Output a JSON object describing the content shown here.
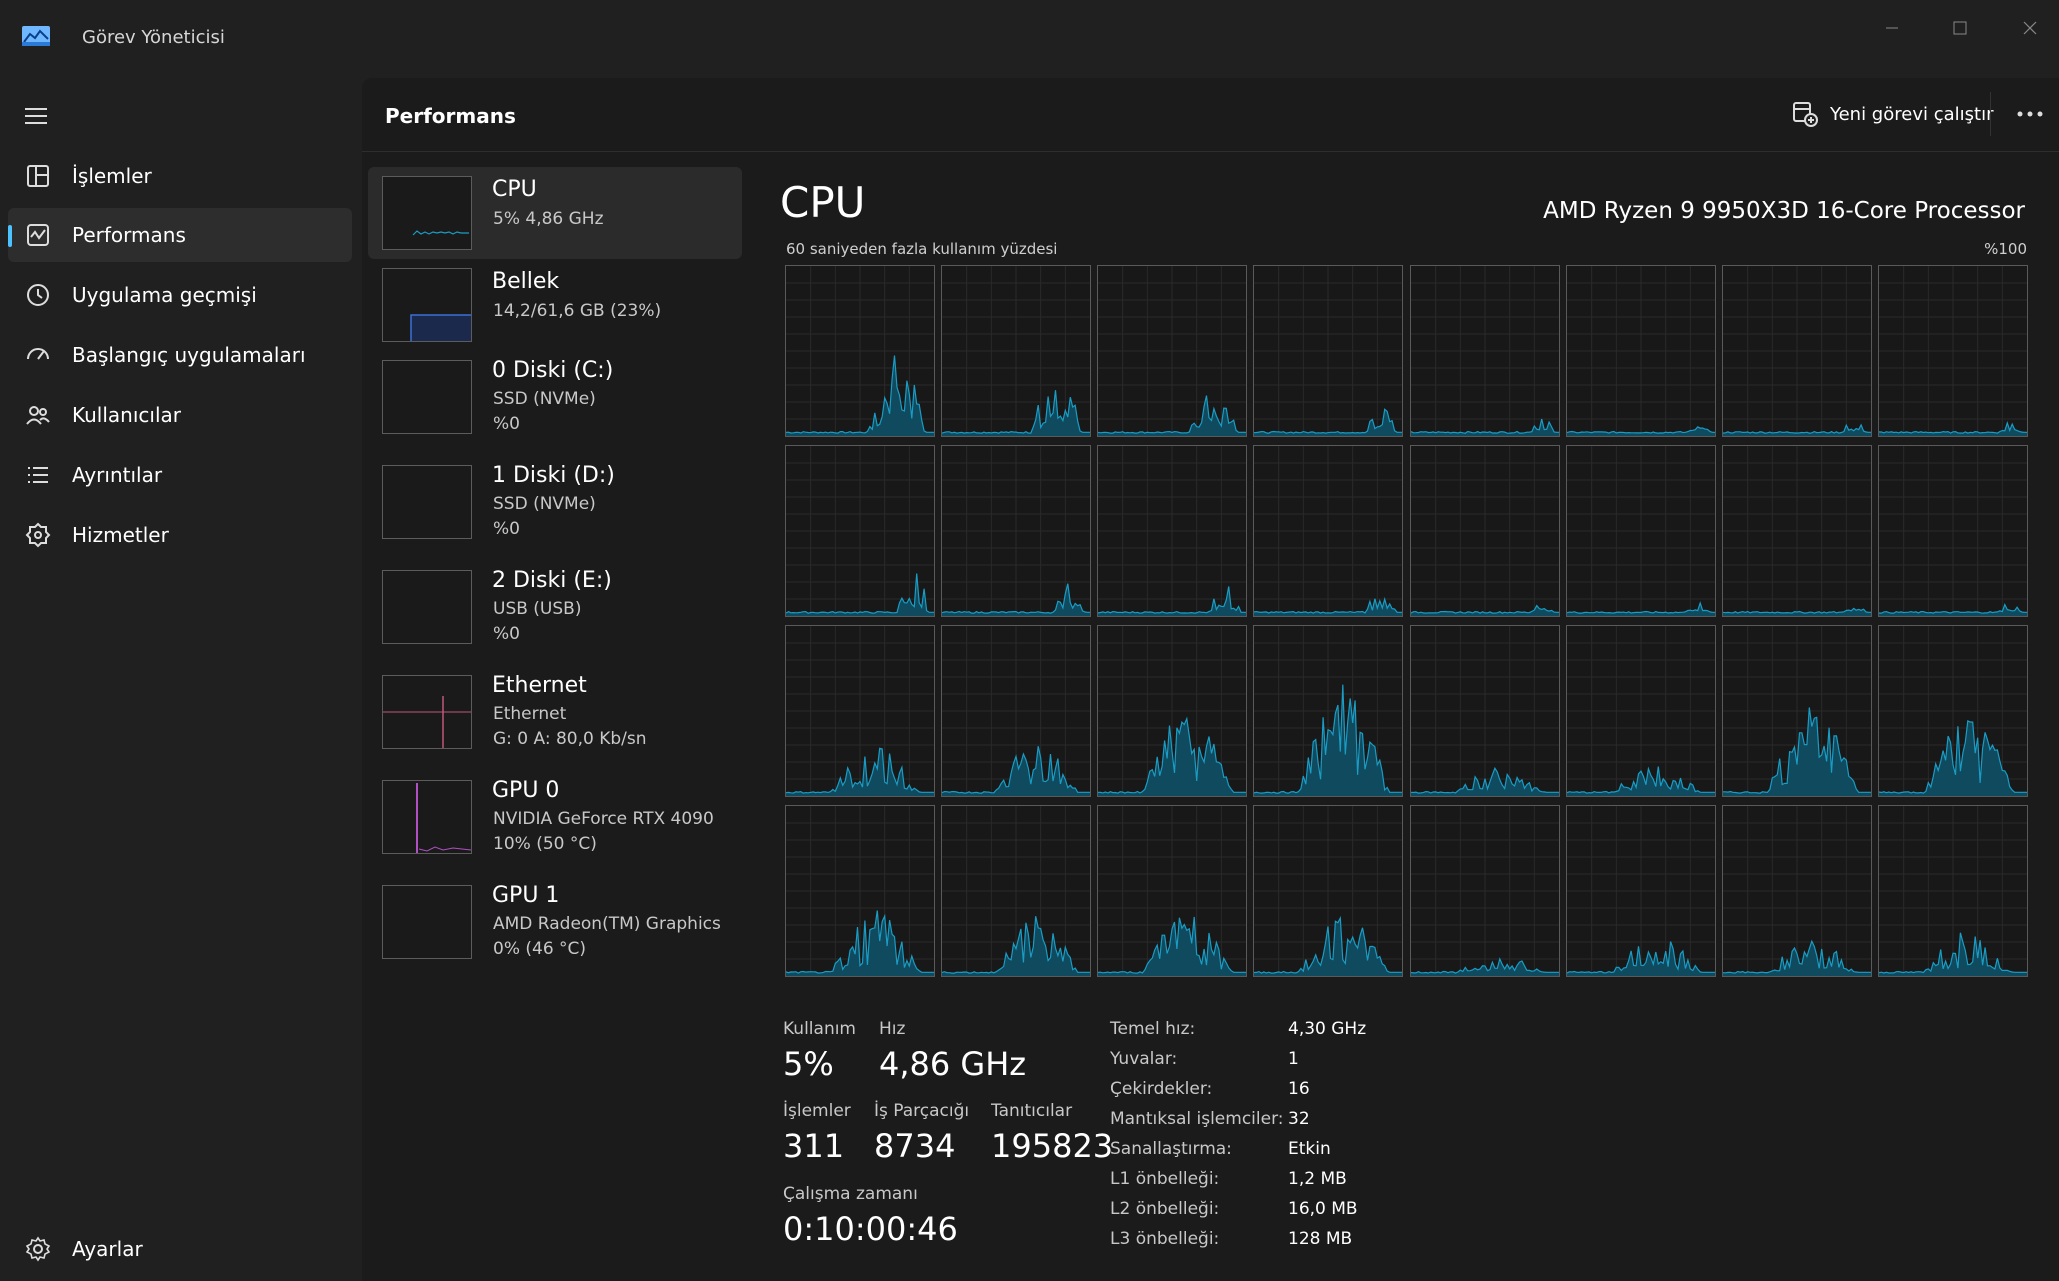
{
  "app": {
    "title": "Görev Yöneticisi"
  },
  "nav": {
    "items": [
      {
        "label": "İşlemler",
        "icon": "processes-icon"
      },
      {
        "label": "Performans",
        "icon": "performance-icon"
      },
      {
        "label": "Uygulama geçmişi",
        "icon": "history-icon"
      },
      {
        "label": "Başlangıç uygulamaları",
        "icon": "startup-icon"
      },
      {
        "label": "Kullanıcılar",
        "icon": "users-icon"
      },
      {
        "label": "Ayrıntılar",
        "icon": "details-icon"
      },
      {
        "label": "Hizmetler",
        "icon": "services-icon"
      }
    ],
    "active_index": 1,
    "settings_label": "Ayarlar"
  },
  "header": {
    "title": "Performans",
    "run_task_label": "Yeni görevi çalıştır"
  },
  "devices": [
    {
      "name": "CPU",
      "line1": "5%  4,86 GHz",
      "line2": ""
    },
    {
      "name": "Bellek",
      "line1": "14,2/61,6 GB (23%)",
      "line2": ""
    },
    {
      "name": "0 Diski (C:)",
      "line1": "SSD (NVMe)",
      "line2": "%0"
    },
    {
      "name": "1 Diski (D:)",
      "line1": "SSD (NVMe)",
      "line2": "%0"
    },
    {
      "name": "2 Diski (E:)",
      "line1": "USB (USB)",
      "line2": "%0"
    },
    {
      "name": "Ethernet",
      "line1": "Ethernet",
      "line2": "G: 0  A: 80,0 Kb/sn"
    },
    {
      "name": "GPU 0",
      "line1": "NVIDIA GeForce RTX 4090",
      "line2": "10%  (50 °C)"
    },
    {
      "name": "GPU 1",
      "line1": "AMD Radeon(TM) Graphics",
      "line2": "0%  (46 °C)"
    }
  ],
  "cpu": {
    "title": "CPU",
    "model": "AMD Ryzen 9 9950X3D 16-Core Processor",
    "chart_caption": "60 saniyeden fazla kullanım yüzdesi",
    "chart_max": "%100",
    "stats": {
      "usage_label": "Kullanım",
      "usage_value": "5%",
      "speed_label": "Hız",
      "speed_value": "4,86 GHz",
      "processes_label": "İşlemler",
      "processes_value": "311",
      "threads_label": "İş Parçacığı",
      "threads_value": "8734",
      "handles_label": "Tanıtıcılar",
      "handles_value": "195823",
      "uptime_label": "Çalışma zamanı",
      "uptime_value": "0:10:00:46"
    },
    "info": [
      {
        "label": "Temel hız:",
        "value": "4,30 GHz"
      },
      {
        "label": "Yuvalar:",
        "value": "1"
      },
      {
        "label": "Çekirdekler:",
        "value": "16"
      },
      {
        "label": "Mantıksal işlemciler:",
        "value": "32"
      },
      {
        "label": "Sanallaştırma:",
        "value": "Etkin"
      },
      {
        "label": "L1 önbelleği:",
        "value": "1,2 MB"
      },
      {
        "label": "L2 önbelleği:",
        "value": "16,0 MB"
      },
      {
        "label": "L3 önbelleği:",
        "value": "128 MB"
      }
    ]
  },
  "colors": {
    "accent": "#4cc2ff",
    "cpu_line": "#1a9cc4",
    "cpu_fill": "#0f4a5e",
    "memory_line": "#3b6fd6",
    "ethernet_line": "#c0567d",
    "gpu_line": "#b14fc4"
  }
}
